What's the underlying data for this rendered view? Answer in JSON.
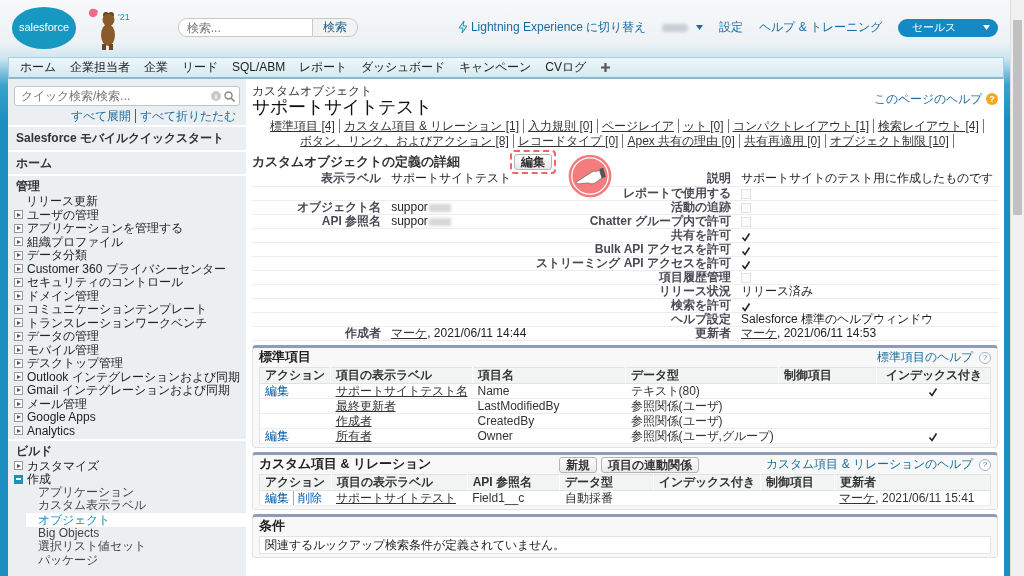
{
  "header": {
    "logo": "salesforce",
    "release_badge": "'21",
    "search": {
      "placeholder": "検索...",
      "button": "検索"
    },
    "lightning_link": "Lightning Experience に切り替え",
    "user_menu": {
      "redacted": true
    },
    "links": [
      "設定",
      "ヘルプ & トレーニング"
    ],
    "app_menu": "セールス"
  },
  "tabs": [
    {
      "label": "ホーム"
    },
    {
      "label": "企業担当者"
    },
    {
      "label": "企業"
    },
    {
      "label": "リード"
    },
    {
      "label": "SQL/ABM"
    },
    {
      "label": "レポート"
    },
    {
      "label": "ダッシュボード"
    },
    {
      "label": "キャンペーン"
    },
    {
      "label": "CVログ"
    }
  ],
  "sidebar": {
    "search": {
      "placeholder": "クイック検索/検索..."
    },
    "expand_all": "すべて展開",
    "collapse_all": "すべて折りたたむ",
    "sections": [
      {
        "kind": "link",
        "title": "Salesforce モバイルクイックスタート"
      },
      {
        "kind": "link",
        "title": "ホーム"
      },
      {
        "kind": "group",
        "title": "管理",
        "items": [
          {
            "label": "リリース更新"
          },
          {
            "label": "ユーザの管理",
            "expanded": false
          },
          {
            "label": "アプリケーションを管理する",
            "expanded": false
          },
          {
            "label": "組織プロファイル",
            "expanded": false
          },
          {
            "label": "データ分類",
            "expanded": false
          },
          {
            "label": "Customer 360 プライバシーセンター",
            "expanded": false
          },
          {
            "label": "セキュリティのコントロール",
            "expanded": false
          },
          {
            "label": "ドメイン管理",
            "expanded": false
          },
          {
            "label": "コミュニケーションテンプレート",
            "expanded": false
          },
          {
            "label": "トランスレーションワークベンチ",
            "expanded": false
          },
          {
            "label": "データの管理",
            "expanded": false
          },
          {
            "label": "モバイル管理",
            "expanded": false
          },
          {
            "label": "デスクトップ管理",
            "expanded": false
          },
          {
            "label": "Outlook インテグレーションおよび同期",
            "expanded": false
          },
          {
            "label": "Gmail インテグレーションおよび同期",
            "expanded": false
          },
          {
            "label": "メール管理",
            "expanded": false
          },
          {
            "label": "Google Apps",
            "expanded": false
          },
          {
            "label": "Analytics",
            "expanded": false
          }
        ]
      },
      {
        "kind": "group",
        "title": "ビルド",
        "items": [
          {
            "label": "カスタマイズ",
            "expanded": false
          },
          {
            "label": "作成",
            "expanded": true,
            "children": [
              {
                "label": "アプリケーション",
                "selected": false
              },
              {
                "label": "カスタム表示ラベル",
                "selected": false
              },
              {
                "label": "オブジェクト",
                "selected": true
              },
              {
                "label": "Big Objects",
                "selected": false
              },
              {
                "label": "選択リスト値セット",
                "selected": false
              },
              {
                "label": "パッケージ",
                "selected": false
              }
            ]
          }
        ]
      }
    ]
  },
  "page": {
    "subtitle": "カスタムオブジェクト",
    "title": "サポートサイトテスト",
    "help_link": "このページのヘルプ",
    "help_icon": "?",
    "related_links": [
      "標準項目 [4]",
      "カスタム項目 & リレーション [1]",
      "入力規則 [0]",
      "ページレイア",
      "ット [0]",
      "コンパクトレイアウト [1]",
      "検索レイアウト [4]",
      "ボタン、リンク、およびアクション [8]",
      "レコードタイプ [0]",
      "Apex 共有の理由 [0]",
      "共有再適用 [0]",
      "オブジェクト制限 [10]"
    ]
  },
  "detail": {
    "title": "カスタムオブジェクトの定義の詳細",
    "edit_button": {
      "label": "編集",
      "highlighted": true
    },
    "rows": [
      {
        "left": {
          "label": "表示ラベル",
          "value": {
            "kind": "text",
            "text": "サポートサイトテスト"
          }
        },
        "right": {
          "label": "説明",
          "value": {
            "kind": "text",
            "text": "サポートサイトのテスト用に作成したものです"
          }
        }
      },
      {
        "right": {
          "label": "レポートで使用する",
          "value": {
            "kind": "checkbox",
            "checked": false
          }
        }
      },
      {
        "left": {
          "label": "オブジェクト名",
          "value": {
            "kind": "redacted",
            "text": "suppor"
          }
        },
        "right": {
          "label": "活動の追跡",
          "value": {
            "kind": "checkbox",
            "checked": false
          }
        }
      },
      {
        "left": {
          "label": "API 参照名",
          "value": {
            "kind": "redacted",
            "text": "suppor"
          }
        },
        "right": {
          "label": "Chatter グループ内で許可",
          "value": {
            "kind": "checkbox",
            "checked": false
          }
        }
      },
      {
        "right": {
          "label": "共有を許可",
          "value": {
            "kind": "checkbox",
            "checked": true
          }
        }
      },
      {
        "right": {
          "label": "Bulk API アクセスを許可",
          "value": {
            "kind": "checkbox",
            "checked": true
          }
        }
      },
      {
        "right": {
          "label": "ストリーミング API アクセスを許可",
          "value": {
            "kind": "checkbox",
            "checked": true
          }
        }
      },
      {
        "right": {
          "label": "項目履歴管理",
          "value": {
            "kind": "checkbox",
            "checked": false
          }
        }
      },
      {
        "right": {
          "label": "リリース状況",
          "value": {
            "kind": "text",
            "text": "リリース済み"
          }
        }
      },
      {
        "right": {
          "label": "検索を許可",
          "value": {
            "kind": "checkbox",
            "checked": true
          }
        }
      },
      {
        "right": {
          "label": "ヘルプ設定",
          "value": {
            "kind": "text",
            "text": "Salesforce 標準のヘルプウィンドウ"
          }
        }
      },
      {
        "left": {
          "label": "作成者",
          "value": {
            "kind": "user",
            "link": "マーケ",
            "text": ", 2021/06/11 14:44"
          }
        },
        "right": {
          "label": "更新者",
          "value": {
            "kind": "user",
            "link": "マーケ",
            "text": ", 2021/06/11 14:53"
          }
        }
      }
    ]
  },
  "standard_fields": {
    "title": "標準項目",
    "help_link": "標準項目のヘルプ",
    "help_icon": "?",
    "columns": [
      "アクション",
      "項目の表示ラベル",
      "項目名",
      "データ型",
      "制御項目",
      "インデックス付き"
    ],
    "rows": [
      {
        "actions": [
          "編集"
        ],
        "label": "サポートサイトテスト名",
        "name": "Name",
        "type": "テキスト(80)",
        "indexed": true
      },
      {
        "label": "最終更新者",
        "name": "LastModifiedBy",
        "type": "参照関係(ユーザ)",
        "indexed": false
      },
      {
        "label": "作成者",
        "name": "CreatedBy",
        "type": "参照関係(ユーザ)",
        "indexed": false
      },
      {
        "actions": [
          "編集"
        ],
        "label": "所有者",
        "name": "Owner",
        "type": "参照関係(ユーザ,グループ)",
        "indexed": true
      }
    ]
  },
  "custom_fields": {
    "title": "カスタム項目 & リレーション",
    "buttons": [
      "新規",
      "項目の連動関係"
    ],
    "help_link": "カスタム項目 & リレーションのヘルプ",
    "help_icon": "?",
    "columns": [
      "アクション",
      "項目の表示ラベル",
      "API 参照名",
      "データ型",
      "インデックス付き",
      "制御項目",
      "更新者"
    ],
    "rows": [
      {
        "actions": [
          "編集",
          "削除"
        ],
        "label": "サポートサイトテスト",
        "name": "Field1__c",
        "type": "自動採番",
        "indexed": false,
        "updated_by": {
          "link": "マーケ",
          "text": ", 2021/06/11 15:41"
        }
      }
    ]
  },
  "conditions": {
    "title": "条件",
    "message": "関連するルックアップ検索条件が定義されていません。"
  }
}
